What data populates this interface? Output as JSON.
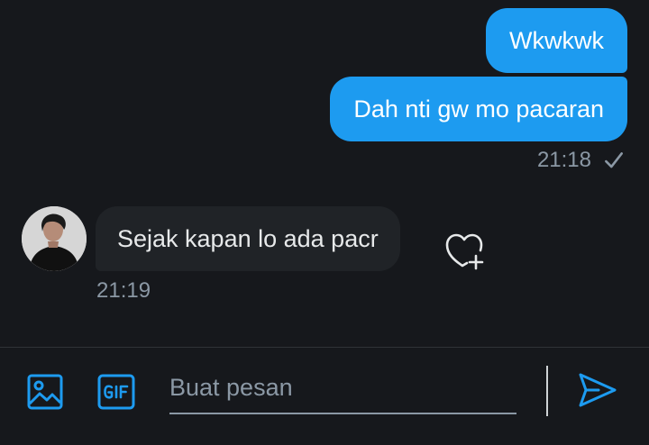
{
  "colors": {
    "background": "#16181c",
    "accent": "#1d9bf0",
    "incoming_bubble": "#202327",
    "muted_text": "#8b98a5"
  },
  "messages": [
    {
      "direction": "outgoing",
      "text": "Wkwkwk"
    },
    {
      "direction": "outgoing",
      "text": "Dah nti gw mo pacaran",
      "time": "21:18",
      "status_icon": "check-icon"
    },
    {
      "direction": "incoming",
      "text": "Sejak kapan lo ada pacr",
      "time": "21:19",
      "avatar": "avatar",
      "reaction_icon": "add-reaction-heart-icon"
    }
  ],
  "composer": {
    "media_icon": "image-icon",
    "gif_icon": "gif-icon",
    "placeholder": "Buat pesan",
    "value": "",
    "send_icon": "send-icon"
  }
}
